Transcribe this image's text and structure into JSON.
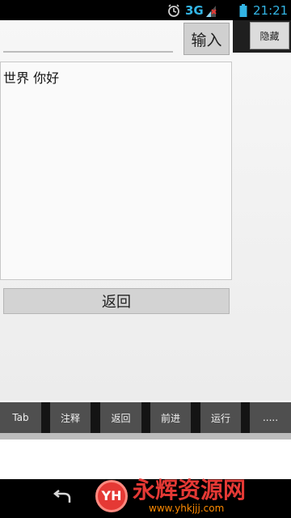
{
  "status_bar": {
    "network": "3G",
    "time": "21:21",
    "icons": [
      "alarm-icon",
      "signal-icon",
      "battery-icon"
    ]
  },
  "header": {
    "hide_button": "隐藏",
    "input_button": "输入",
    "input_value": ""
  },
  "editor": {
    "text": "世界 你好"
  },
  "back_button": "返回",
  "toolbar": {
    "items": [
      "Tab",
      "注释",
      "返回",
      "前进",
      "运行",
      "....."
    ]
  },
  "watermark": {
    "logo": "YH",
    "title": "永辉资源网",
    "url": "www.yhkjjj.com"
  },
  "colors": {
    "status_blue": "#33b5e5",
    "toolbar_bg": "#141414",
    "toolbar_btn": "#4f4f4f",
    "watermark_red": "#e53935"
  }
}
